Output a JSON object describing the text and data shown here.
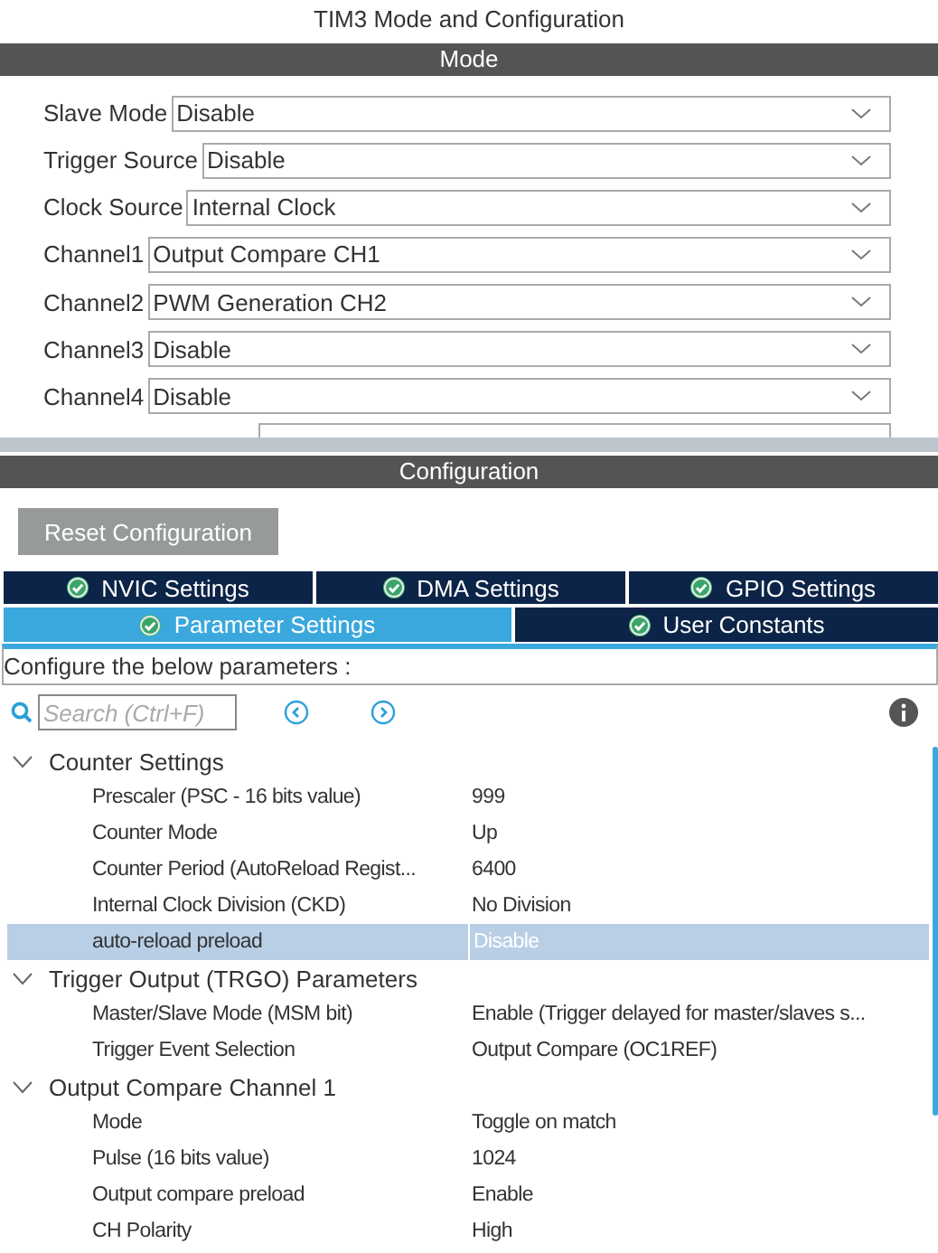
{
  "window": {
    "title": "TIM3 Mode and Configuration"
  },
  "mode": {
    "header": "Mode",
    "fields": [
      {
        "label": "Slave Mode",
        "value": "Disable"
      },
      {
        "label": "Trigger Source",
        "value": "Disable"
      },
      {
        "label": "Clock Source",
        "value": "Internal Clock"
      },
      {
        "label": "Channel1",
        "value": "Output Compare CH1"
      },
      {
        "label": "Channel2",
        "value": "PWM Generation CH2"
      },
      {
        "label": "Channel3",
        "value": "Disable"
      },
      {
        "label": "Channel4",
        "value": "Disable"
      }
    ]
  },
  "configuration": {
    "header": "Configuration",
    "reset_button": "Reset Configuration",
    "tabs": [
      [
        {
          "label": "NVIC Settings",
          "selected": false
        },
        {
          "label": "DMA Settings",
          "selected": false
        },
        {
          "label": "GPIO Settings",
          "selected": false
        }
      ],
      [
        {
          "label": "Parameter Settings",
          "selected": true
        },
        {
          "label": "User Constants",
          "selected": false
        }
      ]
    ],
    "hint": "Configure the below parameters :",
    "search": {
      "placeholder": "Search (Ctrl+F)"
    },
    "tree": [
      {
        "label": "Counter Settings",
        "expanded": true,
        "children": [
          {
            "label": "Prescaler (PSC - 16 bits value)",
            "value": "999",
            "selected": false
          },
          {
            "label": "Counter Mode",
            "value": "Up",
            "selected": false
          },
          {
            "label": "Counter Period (AutoReload Regist...",
            "value": "6400",
            "selected": false
          },
          {
            "label": "Internal Clock Division (CKD)",
            "value": "No Division",
            "selected": false
          },
          {
            "label": "auto-reload preload",
            "value": "Disable",
            "selected": true
          }
        ]
      },
      {
        "label": "Trigger Output (TRGO) Parameters",
        "expanded": true,
        "children": [
          {
            "label": "Master/Slave Mode (MSM bit)",
            "value": "Enable (Trigger delayed for master/slaves s...",
            "selected": false
          },
          {
            "label": "Trigger Event Selection",
            "value": "Output Compare (OC1REF)",
            "selected": false
          }
        ]
      },
      {
        "label": "Output Compare Channel 1",
        "expanded": true,
        "children": [
          {
            "label": "Mode",
            "value": "Toggle on match",
            "selected": false
          },
          {
            "label": "Pulse (16 bits value)",
            "value": "1024",
            "selected": false
          },
          {
            "label": "Output compare preload",
            "value": "Enable",
            "selected": false
          },
          {
            "label": "CH Polarity",
            "value": "High",
            "selected": false
          }
        ]
      }
    ]
  }
}
